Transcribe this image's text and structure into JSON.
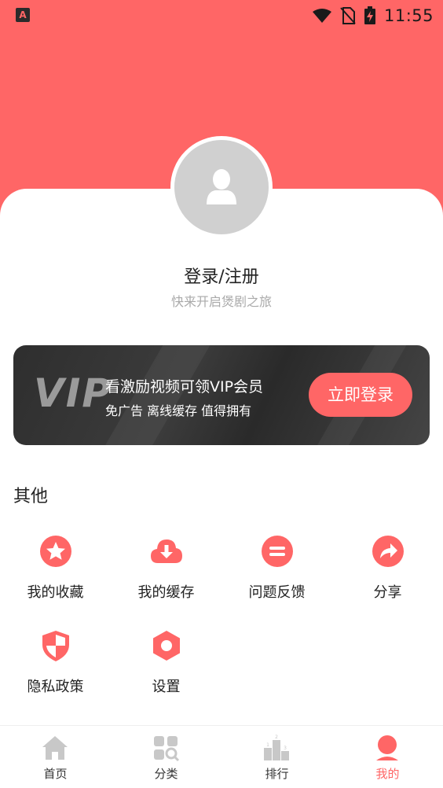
{
  "status_bar": {
    "time": "11:55",
    "app_icon_letter": "A"
  },
  "profile": {
    "login_label": "登录/注册",
    "subtitle": "快来开启煲剧之旅"
  },
  "vip": {
    "logo_text": "VIP",
    "title": "看激励视频可领VIP会员",
    "subtitle": "免广告 离线缓存 值得拥有",
    "button_label": "立即登录"
  },
  "other": {
    "title": "其他",
    "items": [
      {
        "label": "我的收藏",
        "icon": "star-icon"
      },
      {
        "label": "我的缓存",
        "icon": "cloud-download-icon"
      },
      {
        "label": "问题反馈",
        "icon": "feedback-icon"
      },
      {
        "label": "分享",
        "icon": "share-icon"
      },
      {
        "label": "隐私政策",
        "icon": "shield-icon"
      },
      {
        "label": "设置",
        "icon": "settings-icon"
      }
    ]
  },
  "tabs": [
    {
      "label": "首页",
      "icon": "home-icon",
      "active": false
    },
    {
      "label": "分类",
      "icon": "category-icon",
      "active": false
    },
    {
      "label": "排行",
      "icon": "ranking-icon",
      "active": false,
      "podium": [
        "2",
        "1",
        "3"
      ]
    },
    {
      "label": "我的",
      "icon": "profile-icon",
      "active": true
    }
  ],
  "colors": {
    "accent": "#ff6666",
    "icon_gray": "#c8c8c8",
    "vip_bg": "#333333"
  }
}
